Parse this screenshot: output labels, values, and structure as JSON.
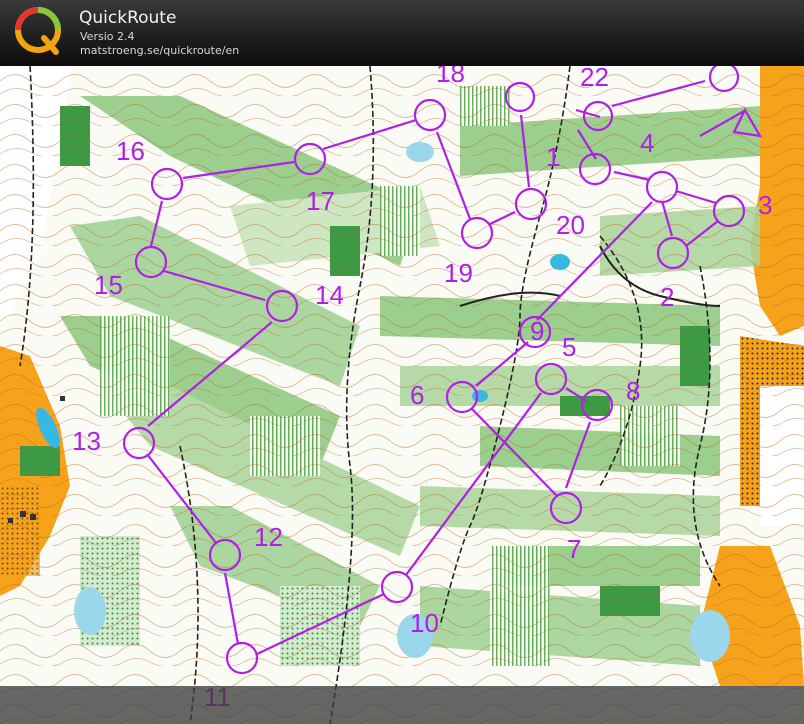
{
  "app": {
    "title": "QuickRoute",
    "version": "Versio 2.4",
    "url": "matstroeng.se/quickroute/en"
  },
  "course": {
    "color": "#b01fe6",
    "controls": [
      {
        "label": "1"
      },
      {
        "label": "2"
      },
      {
        "label": "3"
      },
      {
        "label": "4"
      },
      {
        "label": "5"
      },
      {
        "label": "6"
      },
      {
        "label": "7"
      },
      {
        "label": "8"
      },
      {
        "label": "9"
      },
      {
        "label": "10"
      },
      {
        "label": "11"
      },
      {
        "label": "12"
      },
      {
        "label": "13"
      },
      {
        "label": "14"
      },
      {
        "label": "15"
      },
      {
        "label": "16"
      },
      {
        "label": "17"
      },
      {
        "label": "18"
      },
      {
        "label": "19"
      },
      {
        "label": "20"
      },
      {
        "label": "22"
      }
    ]
  },
  "map_colors": {
    "open_land": "#f7a21b",
    "green": "#66b35c",
    "light_green": "#c7e4ba",
    "water": "#37b8e3",
    "contour": "#b5651d",
    "track": "#222222"
  }
}
